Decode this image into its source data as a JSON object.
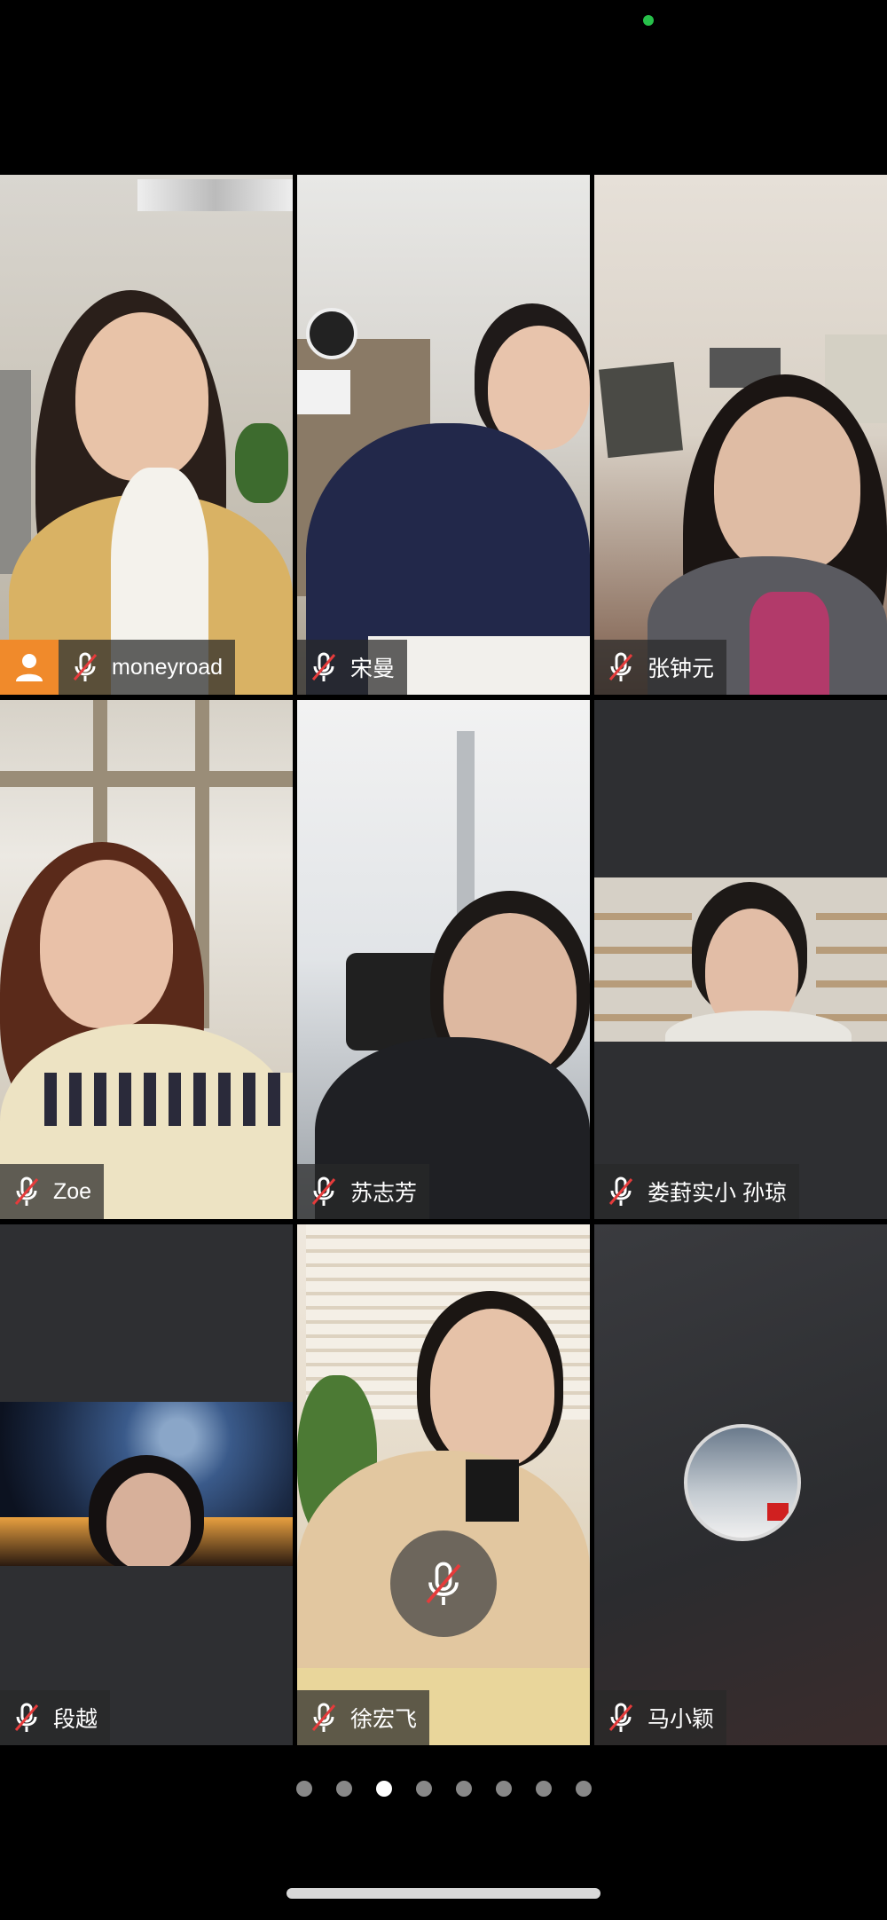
{
  "participants": [
    {
      "name": "moneyroad"
    },
    {
      "name": "宋曼"
    },
    {
      "name": "张钟元"
    },
    {
      "name": "Zoe"
    },
    {
      "name": "苏志芳"
    },
    {
      "name": "娄葑实小 孙琼"
    },
    {
      "name": "段越"
    },
    {
      "name": "徐宏飞"
    },
    {
      "name": "马小颖"
    }
  ],
  "pager": {
    "page_count": 8,
    "current_page": 3
  },
  "colors": {
    "avatar_badge": "#f08a2b",
    "status_dot": "#27c04a",
    "background": "#000000"
  }
}
